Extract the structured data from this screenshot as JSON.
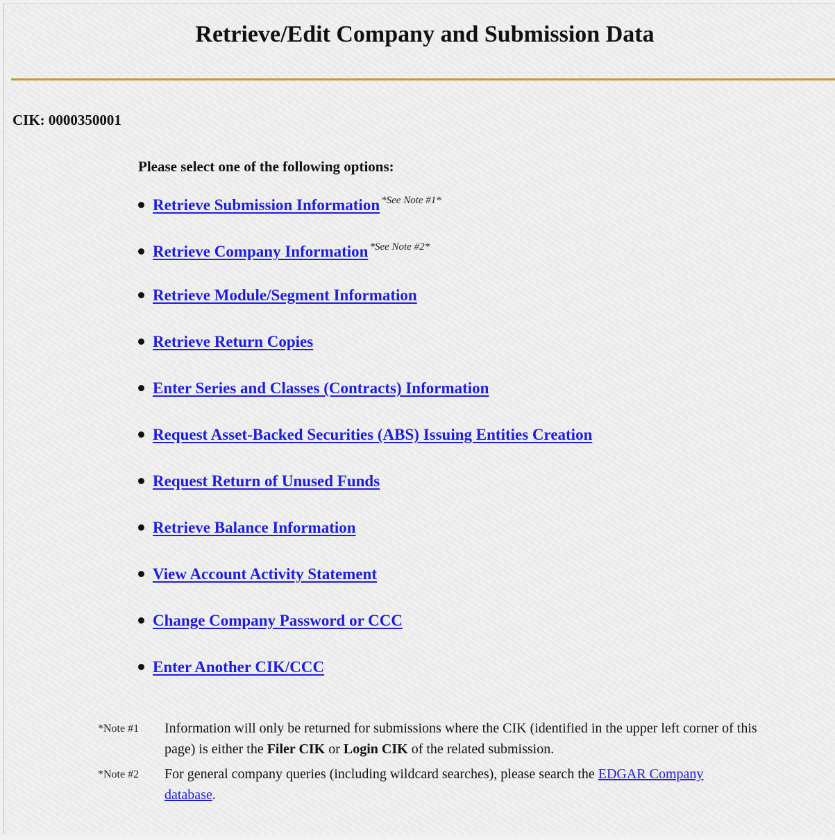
{
  "page": {
    "title": "Retrieve/Edit Company and Submission Data",
    "cik_label": "CIK: 0000350001",
    "prompt": "Please select one of the following options:"
  },
  "options": [
    {
      "label": "Retrieve Submission Information",
      "note": "*See Note #1*"
    },
    {
      "label": "Retrieve Company Information",
      "note": "*See Note #2*"
    },
    {
      "label": "Retrieve Module/Segment Information"
    },
    {
      "label": "Retrieve Return Copies"
    },
    {
      "label": "Enter Series and Classes (Contracts) Information"
    },
    {
      "label": "Request Asset-Backed Securities (ABS) Issuing Entities Creation"
    },
    {
      "label": "Request Return of Unused Funds"
    },
    {
      "label": "Retrieve Balance Information"
    },
    {
      "label": "View Account Activity Statement"
    },
    {
      "label": "Change Company Password or CCC"
    },
    {
      "label": "Enter Another CIK/CCC"
    }
  ],
  "notes": [
    {
      "label": "*Note #1",
      "text_before": "Information will only be returned for submissions where the CIK (identified in the upper left corner of this page) is either the ",
      "bold1": "Filer CIK",
      "text_mid": " or ",
      "bold2": "Login CIK",
      "text_after": " of the related submission."
    },
    {
      "label": "*Note #2",
      "text_before": "For general company queries (including wildcard searches), please search the ",
      "link": "EDGAR Company database",
      "text_after": "."
    }
  ],
  "colors": {
    "link": "#1d1de0",
    "rule": "#c49a34",
    "background": "#ececec"
  }
}
